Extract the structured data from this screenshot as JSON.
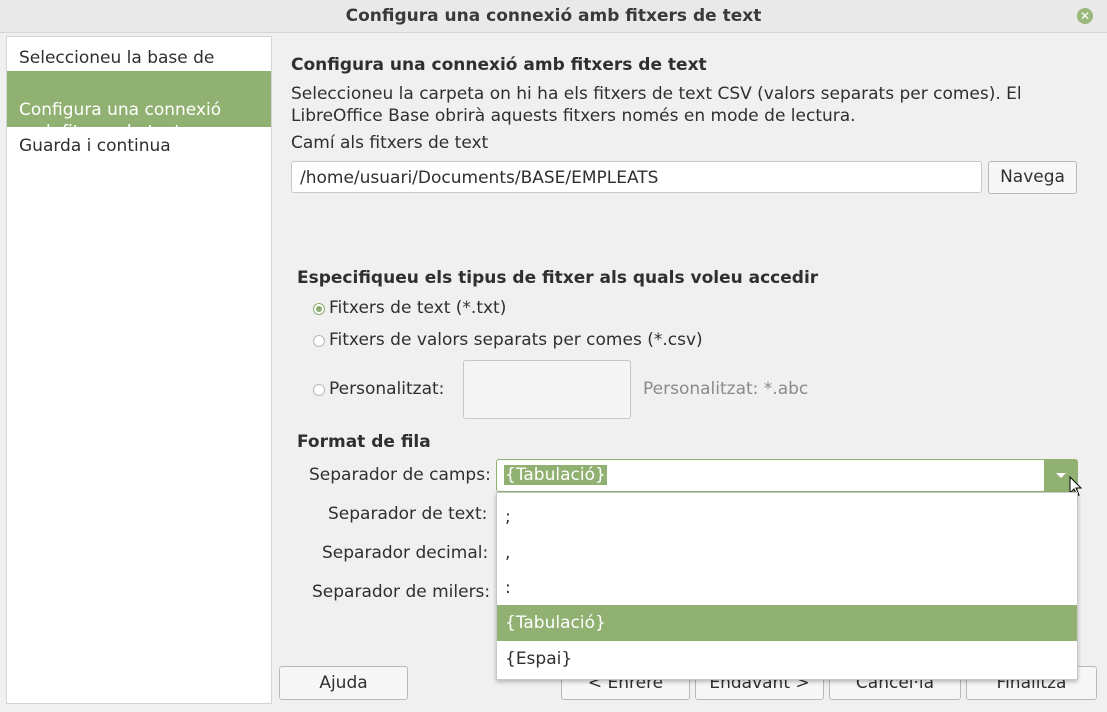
{
  "window": {
    "title": "Configura una connexió amb fitxers de text",
    "close_icon": "close-icon"
  },
  "sidebar": {
    "items": [
      {
        "label": "Seleccioneu la base de dades"
      },
      {
        "label": "Configura una connexió\namb fitxers de text"
      },
      {
        "label": "Guarda i continua"
      }
    ]
  },
  "main": {
    "heading": "Configura una connexió amb fitxers de text",
    "description": "Seleccioneu la carpeta on hi ha els fitxers de text CSV (valors separats per comes). El LibreOffice Base obrirà aquests fitxers només en mode de lectura.",
    "path_label": "Camí als fitxers de text",
    "path_value": "/home/usuari/Documents/BASE/EMPLEATS",
    "browse_label": "Navega",
    "filetype_heading": "Especifiqueu els tipus de fitxer als quals voleu accedir",
    "radio_txt": "Fitxers de text (*.txt)",
    "radio_csv": "Fitxers de valors separats per comes (*.csv)",
    "radio_custom": "Personalitzat:",
    "custom_value": "",
    "custom_hint": "Personalitzat: *.abc",
    "row_format_heading": "Format de fila",
    "field_sep_label": "Separador de camps:",
    "field_sep_value": "{Tabulació}",
    "text_sep_label": "Separador de text:",
    "decimal_sep_label": "Separador decimal:",
    "thousands_sep_label": "Separador de milers:"
  },
  "dropdown": {
    "options": [
      ";",
      ",",
      ":",
      "{Tabulació}",
      "{Espai}"
    ],
    "selected": "{Tabulació}"
  },
  "footer": {
    "help": "Ajuda",
    "back": "< Enrere",
    "next": "Endavant >",
    "cancel": "Cancel·la",
    "finish": "Finalitza"
  },
  "colors": {
    "accent": "#90b171"
  }
}
